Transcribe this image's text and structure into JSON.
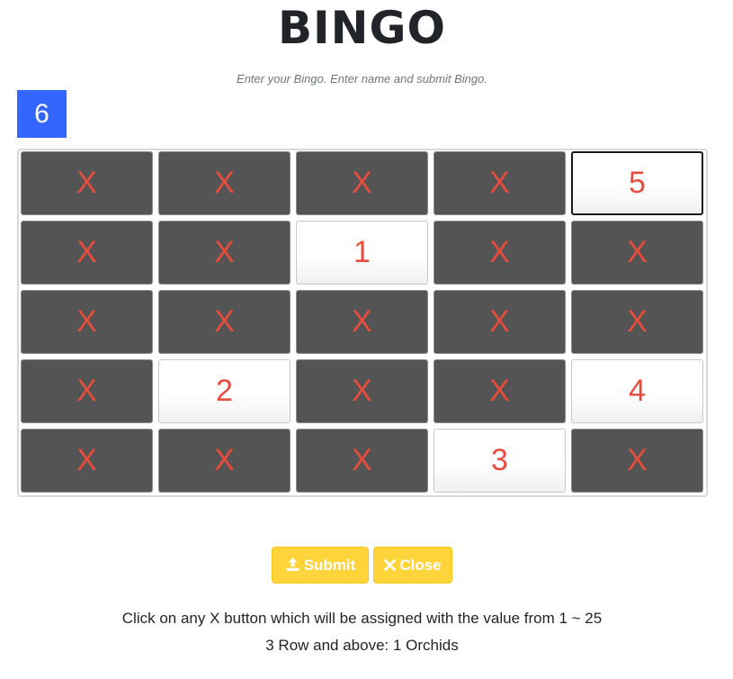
{
  "header": {
    "title": "BINGO",
    "subtitle": "Enter your Bingo. Enter name and submit Bingo."
  },
  "counter": {
    "value": "6"
  },
  "board": {
    "rows": [
      [
        "X",
        "X",
        "X",
        "X",
        "5"
      ],
      [
        "X",
        "X",
        "1",
        "X",
        "X"
      ],
      [
        "X",
        "X",
        "X",
        "X",
        "X"
      ],
      [
        "X",
        "2",
        "X",
        "X",
        "4"
      ],
      [
        "X",
        "X",
        "X",
        "3",
        "X"
      ]
    ],
    "active_cell": "5"
  },
  "actions": {
    "submit_label": "Submit",
    "submit_icon": "upload-icon",
    "close_label": "Close",
    "close_icon": "close-icon"
  },
  "info": {
    "line1": "Click on any X button which will be assigned with the value from 1 ~ 25",
    "line2": "3 Row and above: 1 Orchids"
  },
  "colors": {
    "counter_bg": "#3366ff",
    "cell_marked_bg": "#545454",
    "cell_text": "#e74c3c",
    "button_bg": "#ffd43b"
  }
}
